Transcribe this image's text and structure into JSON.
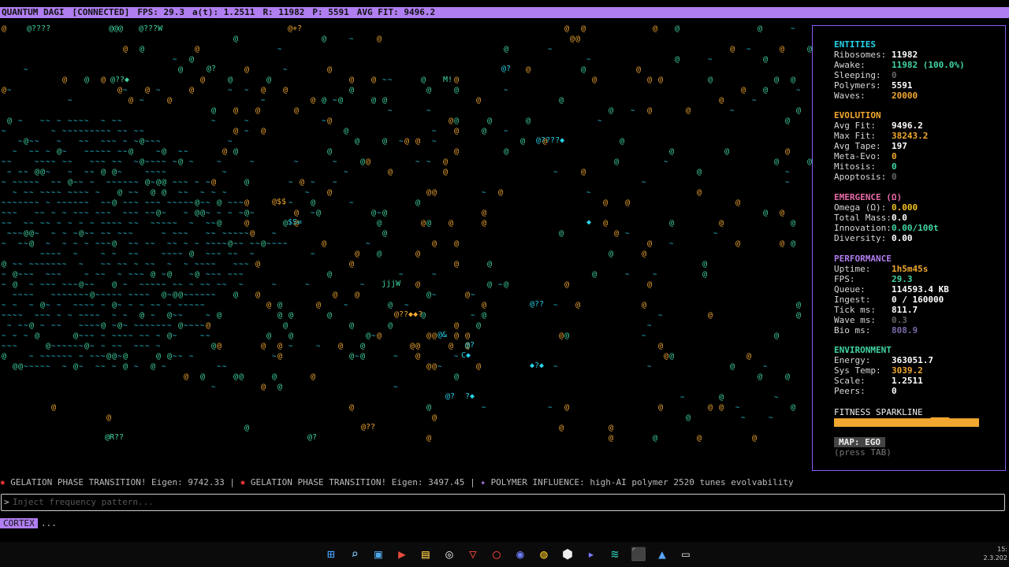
{
  "topbar": {
    "title": "QUANTUM DAGI",
    "status": "[CONNECTED]",
    "fps": "FPS: 29.3",
    "at": "a(t): 1.2511",
    "r": "R: 11982",
    "p": "P: 5591",
    "avg": "AVG FIT: 9496.2"
  },
  "colors": {
    "accent": "#b07ef0",
    "green": "#41d6a3",
    "orange": "#f2a830",
    "cyan": "#28d3ea",
    "yellow": "#f0c020",
    "pink": "#e86aa6"
  },
  "field": {
    "glyphs": [
      "@",
      "~",
      "?",
      "$",
      "W",
      "M",
      "!",
      "j",
      "R",
      "C",
      "S",
      "="
    ],
    "labels": [
      {
        "text": "@????",
        "color": "green"
      },
      {
        "text": "@@@",
        "color": "green"
      },
      {
        "text": "@???W",
        "color": "green"
      },
      {
        "text": "@+?",
        "color": "orange"
      },
      {
        "text": "@?",
        "color": "green"
      },
      {
        "text": "@??◆",
        "color": "green"
      },
      {
        "text": "M!",
        "color": "green"
      },
      {
        "text": "@?",
        "color": "cyan"
      },
      {
        "text": "@????◆",
        "color": "cyan"
      },
      {
        "text": "@$$",
        "color": "orange"
      },
      {
        "text": "$S=",
        "color": "cyan"
      },
      {
        "text": "◆",
        "color": "cyan"
      },
      {
        "text": "jjjW",
        "color": "green"
      },
      {
        "text": "@??",
        "color": "cyan"
      },
      {
        "text": "@??◆◆?",
        "color": "orange"
      },
      {
        "text": "@&",
        "color": "cyan"
      },
      {
        "text": "@?",
        "color": "cyan"
      },
      {
        "text": "C◆",
        "color": "cyan"
      },
      {
        "text": "◆?◆",
        "color": "cyan"
      },
      {
        "text": "@?",
        "color": "cyan"
      },
      {
        "text": "?◆",
        "color": "cyan"
      },
      {
        "text": "@??",
        "color": "orange"
      },
      {
        "text": "@R??",
        "color": "green"
      },
      {
        "text": "@?",
        "color": "green"
      }
    ]
  },
  "panel": {
    "entities": {
      "heading": "ENTITIES",
      "rows": [
        {
          "label": "Ribosomes:",
          "value": "11982",
          "color": "#ffffff"
        },
        {
          "label": "Awake:",
          "value": "11982 (100.0%)",
          "color": "#41d6a3"
        },
        {
          "label": "Sleeping:",
          "value": "0",
          "color": "#666666"
        },
        {
          "label": "Polymers:",
          "value": "5591",
          "color": "#ffffff"
        },
        {
          "label": "Waves:",
          "value": "20000",
          "color": "#f2a830"
        }
      ]
    },
    "evolution": {
      "heading": "EVOLUTION",
      "rows": [
        {
          "label": "Avg Fit:",
          "value": "9496.2",
          "color": "#ffffff"
        },
        {
          "label": "Max Fit:",
          "value": "38243.2",
          "color": "#f2a830"
        },
        {
          "label": "Avg Tape:",
          "value": "197",
          "color": "#ffffff"
        },
        {
          "label": "Meta-Evo:",
          "value": "0",
          "color": "#f2a830"
        },
        {
          "label": "Mitosis:",
          "value": "0",
          "color": "#41d6a3"
        },
        {
          "label": "Apoptosis:",
          "value": "0",
          "color": "#666666"
        }
      ]
    },
    "emergence": {
      "heading": "EMERGENCE (Ω)",
      "rows": [
        {
          "label": "Omega (Ω):",
          "value": "0.000",
          "color": "#f0c020"
        },
        {
          "label": "Total Mass:",
          "value": "0.0",
          "color": "#ffffff"
        },
        {
          "label": "Innovation:",
          "value": "0.00/100t",
          "color": "#41d6a3"
        },
        {
          "label": "Diversity:",
          "value": "0.00",
          "color": "#ffffff"
        }
      ]
    },
    "performance": {
      "heading": "PERFORMANCE",
      "rows": [
        {
          "label": "Uptime:",
          "value": "1h5m45s",
          "color": "#f2a830"
        },
        {
          "label": "FPS:",
          "value": "29.3",
          "color": "#41d6a3"
        },
        {
          "label": "Queue:",
          "value": "114593.4 KB",
          "color": "#ffffff"
        },
        {
          "label": "Ingest:",
          "value": "0 / 160000",
          "color": "#ffffff"
        },
        {
          "label": "Tick ms:",
          "value": "811.7",
          "color": "#ffffff"
        },
        {
          "label": "Wave ms:",
          "value": "0.3",
          "color": "#666666"
        },
        {
          "label": "Bio ms:",
          "value": "808.9",
          "color": "#7a6aa8"
        }
      ]
    },
    "environment": {
      "heading": "ENVIRONMENT",
      "rows": [
        {
          "label": "Energy:",
          "value": "363051.7",
          "color": "#ffffff"
        },
        {
          "label": "Sys Temp:",
          "value": "3039.2",
          "color": "#f2a830"
        },
        {
          "label": "Scale:",
          "value": "1.2511",
          "color": "#ffffff"
        },
        {
          "label": "Peers:",
          "value": "0",
          "color": "#ffffff"
        }
      ]
    },
    "sparkline_label": "FITNESS SPARKLINE",
    "sparkline": [
      0.9,
      0.9,
      0.9,
      0.9,
      0.9,
      0.9,
      0.9,
      0.9,
      0.9,
      0.9,
      0.9,
      0.9,
      0.9,
      0.9,
      0.9,
      0.9,
      1.0,
      1.0,
      1.0,
      0.9,
      0.9,
      0.9,
      0.9,
      0.9
    ],
    "map_badge": "MAP: EGO",
    "map_hint": "(press TAB)"
  },
  "event_log": {
    "e1": "GELATION PHASE TRANSITION! Eigen: 9742.33",
    "sep1": "|",
    "e2": "GELATION PHASE TRANSITION! Eigen: 3497.45",
    "sep2": "|",
    "e3": "POLYMER INFLUENCE: high-AI polymer 2520 tunes evolvability"
  },
  "input": {
    "prompt": ">",
    "placeholder": "Inject frequency pattern..."
  },
  "cortex": {
    "tag": "CORTEX",
    "status": "..."
  },
  "taskbar": {
    "icons": [
      "windows-start-icon",
      "search-icon",
      "gallery-icon",
      "video-app-icon",
      "file-explorer-icon",
      "chrome-canary-icon",
      "vivaldi-icon",
      "opera-icon",
      "discord-icon",
      "chrome-icon",
      "capcut-icon",
      "media-player-icon",
      "waves-app-icon",
      "cube-app-icon",
      "arc-icon",
      "terminal-icon"
    ],
    "clock_time": "15:",
    "clock_date": "2.3.202"
  }
}
